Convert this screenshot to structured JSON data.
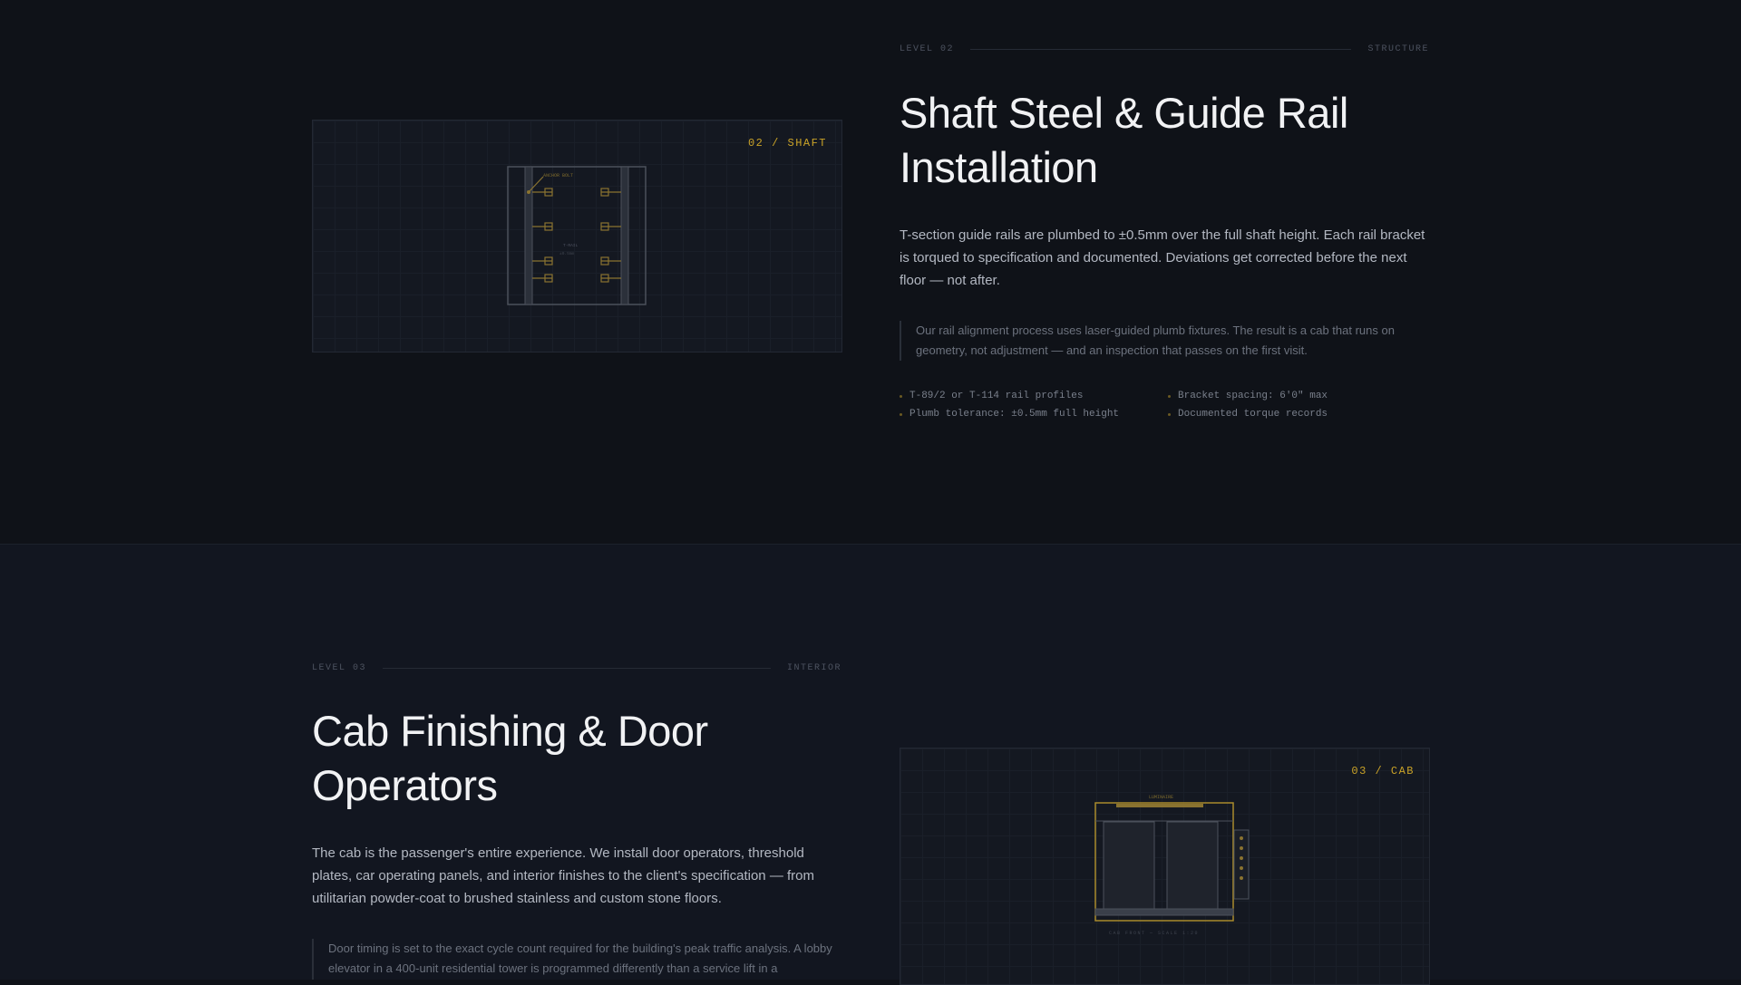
{
  "section1": {
    "level_label": "LEVEL 02",
    "category": "STRUCTURE",
    "title_line1": "Shaft Steel & Guide Rail",
    "title_line2": "Installation",
    "body": "T-section guide rails are plumbed to ±0.5mm over the full shaft height. Each rail bracket is torqued to specification and documented. Deviations get corrected before the next floor — not after.",
    "quote": "Our rail alignment process uses laser-guided plumb fixtures. The result is a cab that runs on geometry, not adjustment — and an inspection that passes on the first visit.",
    "specs": [
      "T-89/2 or T-114 rail profiles",
      "Bracket spacing: 6'0\" max",
      "Plumb tolerance: ±0.5mm full height",
      "Documented torque records"
    ],
    "panel_tag": "02 / SHAFT",
    "diagram_label_top": "ANCHOR BOLT",
    "diagram_label_mid": "T-RAIL",
    "diagram_label_mid2": "±0.5mm"
  },
  "section2": {
    "level_label": "LEVEL 03",
    "category": "INTERIOR",
    "title_line1": "Cab Finishing & Door",
    "title_line2": "Operators",
    "body": "The cab is the passenger's entire experience. We install door operators, threshold plates, car operating panels, and interior finishes to the client's specification — from utilitarian powder-coat to brushed stainless and custom stone floors.",
    "quote": "Door timing is set to the exact cycle count required for the building's peak traffic analysis. A lobby elevator in a 400-unit residential tower is programmed differently than a service lift in a",
    "panel_tag": "03 / CAB",
    "diagram_label_top": "LUMINAIRE",
    "diagram_label_bottom": "CAB FRONT — SCALE 1:20"
  },
  "colors": {
    "background": "#0f1218",
    "accent": "#c9a227",
    "text_primary": "#f1f2f4",
    "text_body": "#b3b8c2",
    "text_muted": "#6c727e"
  }
}
